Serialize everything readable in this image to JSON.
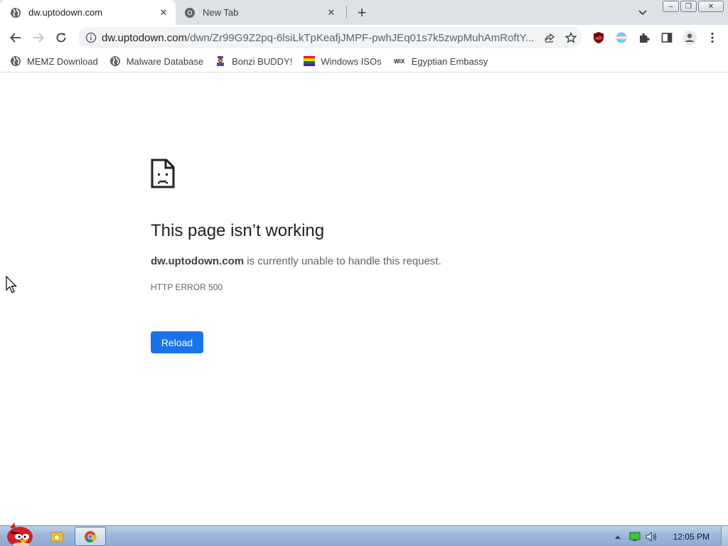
{
  "tabs": [
    {
      "title": "dw.uptodown.com",
      "active": true
    },
    {
      "title": "New Tab",
      "active": false
    }
  ],
  "new_tab_symbol": "+",
  "window_buttons": {
    "minimize": "‒",
    "restore": "❐",
    "close": "✕"
  },
  "toolbar": {
    "url_host": "dw.uptodown.com",
    "url_path": "/dwn/Zr99G9Z2pq-6lsiLkTpKeafjJMPF-pwhJEq01s7k5zwpMuhAmRoftY..."
  },
  "extensions": [
    {
      "name": "ublock-icon",
      "label": "uO"
    },
    {
      "name": "flag-extension-icon"
    },
    {
      "name": "extensions-puzzle-icon"
    },
    {
      "name": "side-panel-icon"
    },
    {
      "name": "profile-icon"
    },
    {
      "name": "menu-kebab-icon"
    }
  ],
  "bookmarks": [
    {
      "label": "MEMZ Download",
      "icon": "globe-icon"
    },
    {
      "label": "Malware Database",
      "icon": "globe-icon"
    },
    {
      "label": "Bonzi BUDDY!",
      "icon": "bonzi-icon"
    },
    {
      "label": "Windows ISOs",
      "icon": "rainbow-flag-icon"
    },
    {
      "label": "Egyptian Embassy",
      "icon": "wix-icon",
      "icon_text": "WiX"
    }
  ],
  "error": {
    "title": "This page isn’t working",
    "host": "dw.uptodown.com",
    "message": " is currently unable to handle this request.",
    "code": "HTTP ERROR 500",
    "reload_label": "Reload"
  },
  "taskbar": {
    "clock": "12:05 PM"
  },
  "colors": {
    "accent": "#1a73e8",
    "tabstrip": "#dee1e6",
    "omnibox": "#f1f3f4"
  }
}
